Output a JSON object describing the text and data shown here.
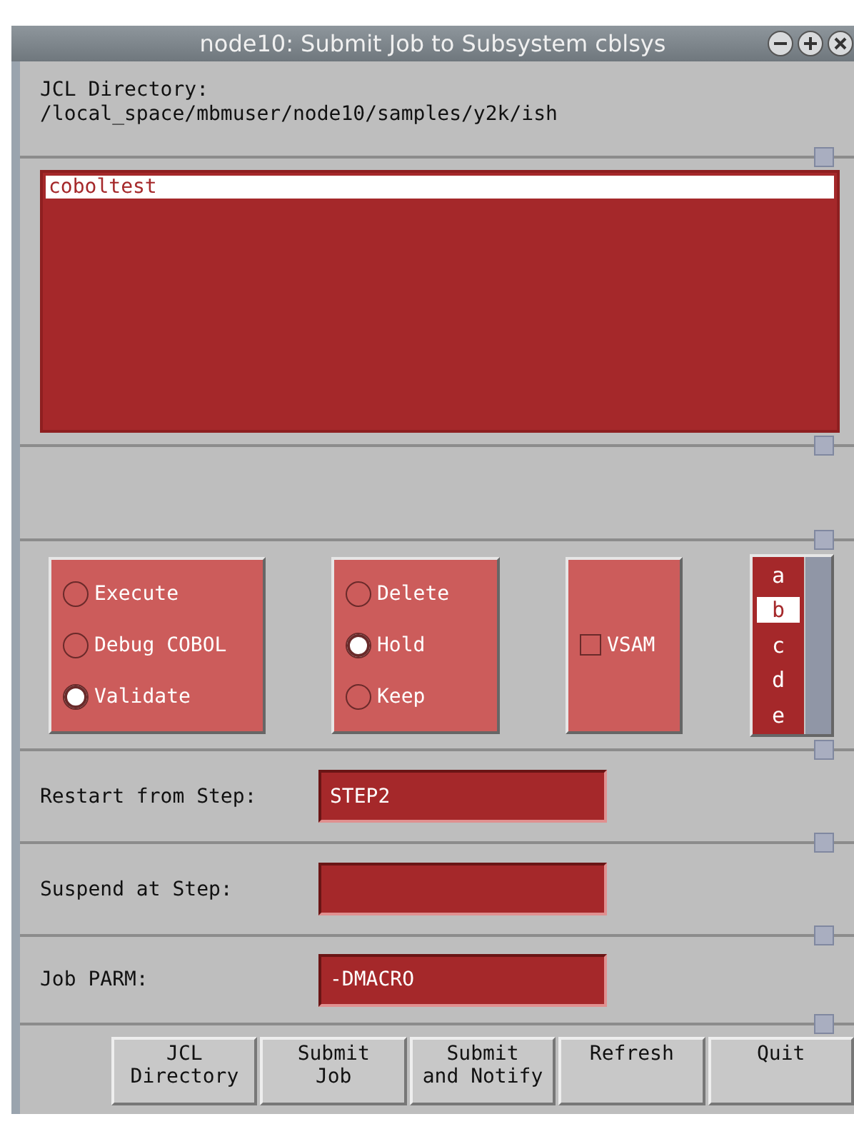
{
  "window": {
    "title": "node10: Submit Job to Subsystem cblsys"
  },
  "jcl_directory": {
    "label": "JCL Directory:",
    "path": "/local_space/mbmuser/node10/samples/y2k/ish"
  },
  "job_list": [
    {
      "name": "coboltest",
      "selected": true
    }
  ],
  "run_mode": [
    {
      "label": "Execute",
      "selected": false
    },
    {
      "label": "Debug COBOL",
      "selected": false
    },
    {
      "label": "Validate",
      "selected": true
    }
  ],
  "disposition": [
    {
      "label": "Delete",
      "selected": false
    },
    {
      "label": "Hold",
      "selected": true
    },
    {
      "label": "Keep",
      "selected": false
    }
  ],
  "vsam": {
    "label": "VSAM",
    "checked": false
  },
  "class_list": [
    {
      "label": "a",
      "selected": false
    },
    {
      "label": "b",
      "selected": true
    },
    {
      "label": "c",
      "selected": false
    },
    {
      "label": "d",
      "selected": false
    },
    {
      "label": "e",
      "selected": false
    }
  ],
  "fields": [
    {
      "label": "Restart from Step:",
      "value": "STEP2"
    },
    {
      "label": "Suspend at Step:"
    },
    {
      "label": "Job PARM:",
      "value": "-DMACRO"
    }
  ],
  "buttons": [
    "JCL\nDirectory",
    "Submit\nJob",
    "Submit\nand Notify",
    "Refresh",
    "Quit"
  ]
}
